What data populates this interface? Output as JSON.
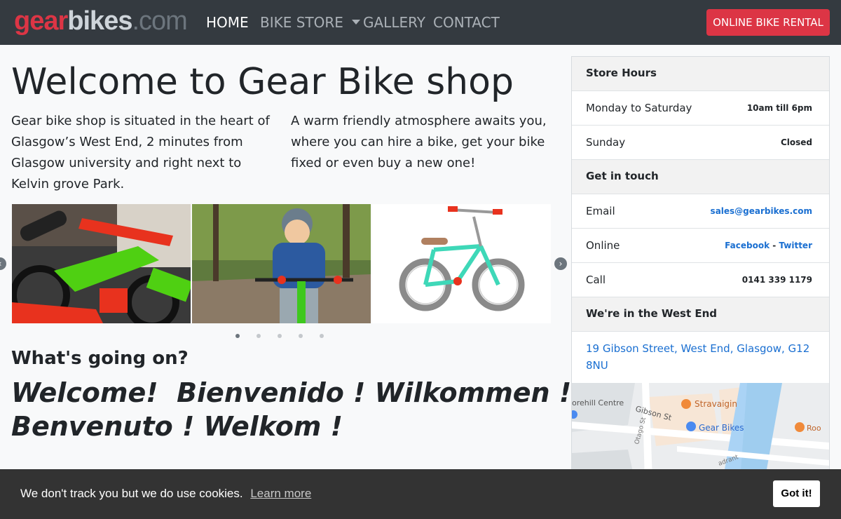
{
  "brand": {
    "part1": "gear",
    "part2": "bikes",
    "part3": ".com"
  },
  "nav": {
    "home": "HOME",
    "bike_store": "BIKE STORE",
    "gallery": "GALLERY",
    "contact": "CONTACT",
    "rental_button": "ONLINE BIKE RENTAL"
  },
  "main": {
    "title": "Welcome to Gear Bike shop",
    "intro_left": "Gear bike shop is situated in the heart of Glasgow’s West End, 2 minutes from Glasgow university and right next to Kelvin grove Park.",
    "intro_right": "A warm friendly atmosphere awaits you, where you can hire a bike, get your bike fixed or even buy a new one!",
    "whats_on": "What's going on?",
    "welcome_line1": "Welcome!  Bienvenido ! Wilkommen !",
    "welcome_line2": "Benvenuto ! Welkom !"
  },
  "carousel": {
    "indicator_count": 5,
    "active_index": 0
  },
  "sidebar": {
    "hours_title": "Store Hours",
    "mon_sat_label": "Monday to Saturday",
    "mon_sat_value": "10am till 6pm",
    "sunday_label": "Sunday",
    "sunday_value": "Closed",
    "contact_title": "Get in touch",
    "email_label": "Email",
    "email_value": "sales@gearbikes.com",
    "online_label": "Online",
    "facebook": "Facebook",
    "separator": " - ",
    "twitter": "Twitter",
    "call_label": "Call",
    "call_value": "0141 339 1179",
    "location_title": "We're in the West End",
    "address": "19 Gibson Street, West End, Glasgow, G12 8NU"
  },
  "map": {
    "label_centre": "orehill Centre",
    "label_street": "Gibson St",
    "label_poi1": "Stravaigin",
    "label_poi2": "Gear Bikes",
    "label_poi3": "Roo",
    "label_road1": "Otago St",
    "label_road2": "adrant"
  },
  "cookie": {
    "message": "We don't track you but we do use cookies.",
    "learn_more": "Learn more",
    "button": "Got it!"
  },
  "colors": {
    "navbar": "#343a40",
    "brand_red": "#dc3545",
    "link_blue": "#1a6fd1",
    "cookie_bar": "#333333"
  }
}
